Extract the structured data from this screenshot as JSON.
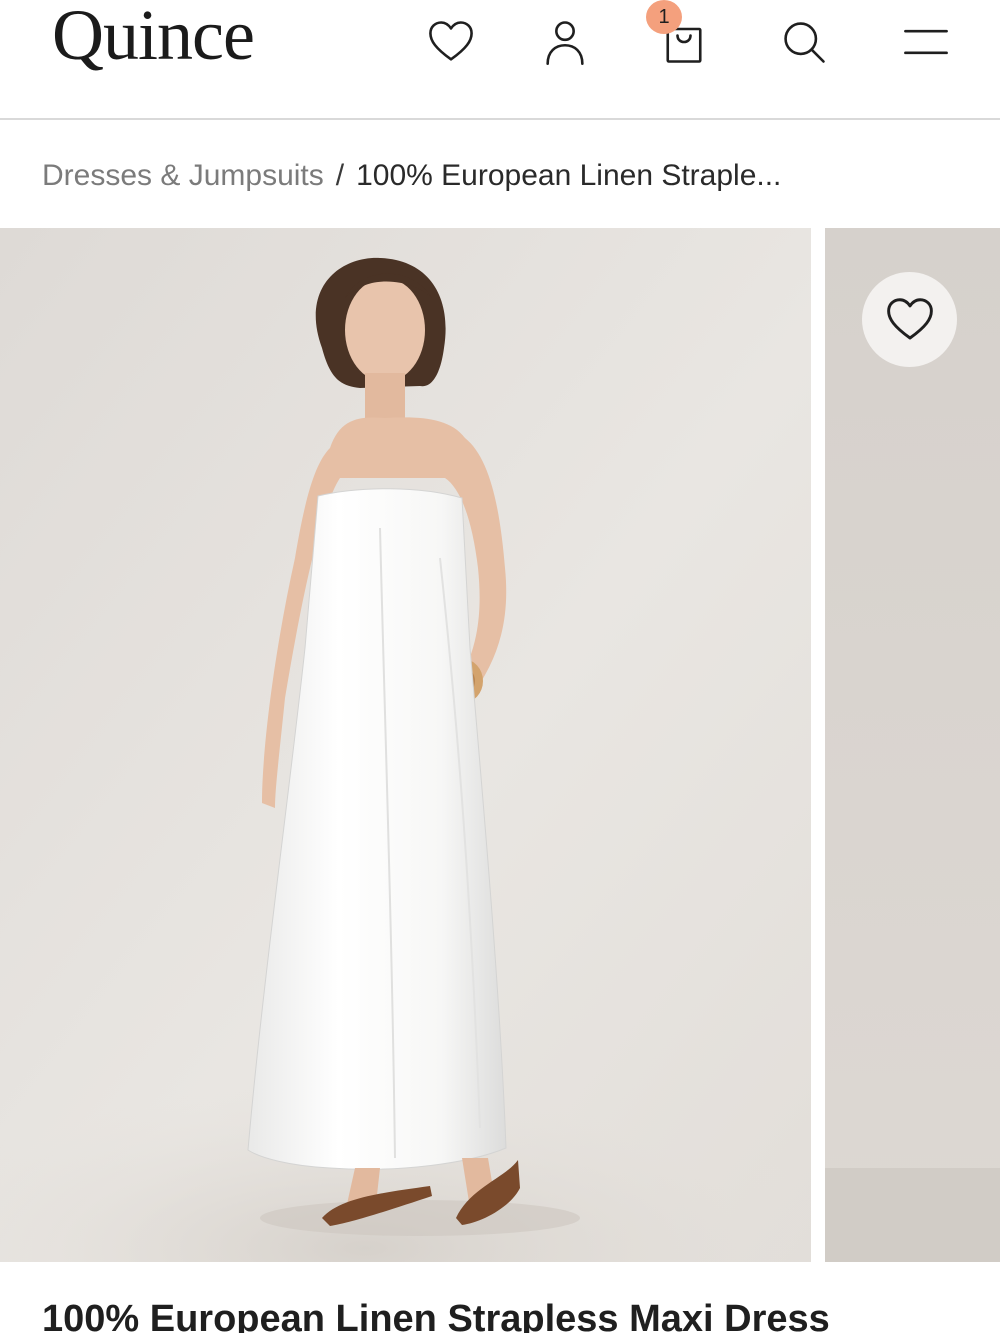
{
  "header": {
    "logo": "Quince",
    "cart_count": "1",
    "icons": [
      "heart-icon",
      "account-icon",
      "bag-icon",
      "search-icon",
      "menu-icon"
    ]
  },
  "breadcrumb": {
    "category": "Dresses & Jumpsuits",
    "separator": "/",
    "current": "100% European Linen Straple..."
  },
  "gallery": {
    "favorite_icon": "heart-icon"
  },
  "product": {
    "title": "100% European Linen Strapless Maxi Dress"
  },
  "colors": {
    "badge": "#f4a07d",
    "backdrop": "#e4e0dc",
    "text": "#1f1f1f",
    "muted": "#7b7b7b"
  }
}
